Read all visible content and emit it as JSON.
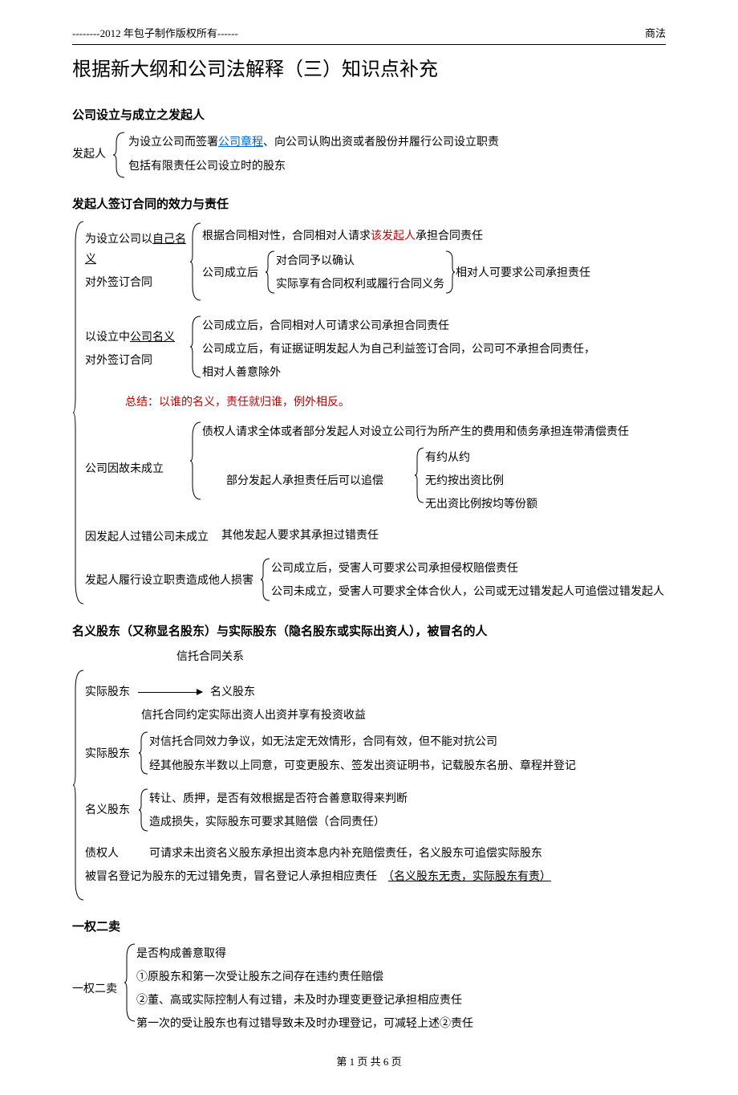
{
  "header": {
    "left": "--------2012 年包子制作版权所有------",
    "right": "商法"
  },
  "title": "根据新大纲和公司法解释（三）知识点补充",
  "sec1": {
    "title": "公司设立与成立之发起人",
    "label": "发起人",
    "item1a": "为设立公司而签署",
    "item1b": "公司章程",
    "item1c": "、向公司认购出资或者股份并履行公司设立职责",
    "item2": "包括有限责任公司设立时的股东"
  },
  "sec2": {
    "title": "发起人签订合同的效力与责任",
    "g1_l1a": "为设立公司以",
    "g1_l1b": "自己名义",
    "g1_l2": "对外签订合同",
    "g1_r1a": "根据合同相对性，合同相对人请求",
    "g1_r1b": "该发起人",
    "g1_r1c": "承担合同责任",
    "g1_r2_label": "公司成立后",
    "g1_r2_1": "对合同予以确认",
    "g1_r2_2": "实际享有合同权利或履行合同义务",
    "g1_r2_tail": "相对人可要求公司承担责任",
    "g2_l1a": "以设立中",
    "g2_l1b": "公司名义",
    "g2_l2": "对外签订合同",
    "g2_r1": "公司成立后，合同相对人可请求公司承担合同责任",
    "g2_r2": "公司成立后，有证据证明发起人为自己利益签订合同，公司可不承担合同责任，",
    "g2_r3": "相对人善意除外",
    "summary_label": "总结：以谁的名义，责任就归谁，例外相反。",
    "g3_l": "公司因故未成立",
    "g3_r1": "债权人请求全体或者部分发起人对设立公司行为所产生的费用和债务承担连带清偿责任",
    "g3_r2_label": "部分发起人承担责任后可以追偿",
    "g3_r2_1": "有约从约",
    "g3_r2_2": "无约按出资比例",
    "g3_r2_3": "无出资比例按均等份额",
    "g4_l": "因发起人过错公司未成立",
    "g4_r": "其他发起人要求其承担过错责任",
    "g5_l": "发起人履行设立职责造成他人损害",
    "g5_r1": "公司成立后，受害人可要求公司承担侵权赔偿责任",
    "g5_r2": "公司未成立，受害人可要求全体合伙人，公司或无过错发起人可追偿过错发起人"
  },
  "sec3": {
    "title": "名义股东（又称显名股东）与实际股东（隐名股东或实际出资人），被冒名的人",
    "trust_label": "信托合同关系",
    "actual": "实际股东",
    "nominal": "名义股东",
    "trust_desc": "信托合同约定实际出资人出资并享有投资收益",
    "a_label": "实际股东",
    "a_1": "对信托合同效力争议，如无法定无效情形，合同有效，但不能对抗公司",
    "a_2": "经其他股东半数以上同意，可变更股东、签发出资证明书，记载股东名册、章程并登记",
    "b_label": "名义股东",
    "b_1": "转让、质押，是否有效根据是否符合善意取得来判断",
    "b_2": "造成损失，实际股东可要求其赔偿（合同责任）",
    "c_label": "债权人",
    "c_text": "可请求未出资名义股东承担出资本息内补充赔偿责任，名义股东可追偿实际股东",
    "d_text1": "被冒名登记为股东的无过错免责，冒名登记人承担相应责任　",
    "d_text2": "（名义股东无责，实际股东有责）"
  },
  "sec4": {
    "title": "一权二卖",
    "label": "一权二卖",
    "i1": "是否构成善意取得",
    "i2": "①原股东和第一次受让股东之间存在违约责任赔偿",
    "i3": "②董、高或实际控制人有过错，未及时办理变更登记承担相应责任",
    "i4": "第一次的受让股东也有过错导致未及时办理登记，可减轻上述②责任"
  },
  "footer": "第 1 页 共 6 页"
}
